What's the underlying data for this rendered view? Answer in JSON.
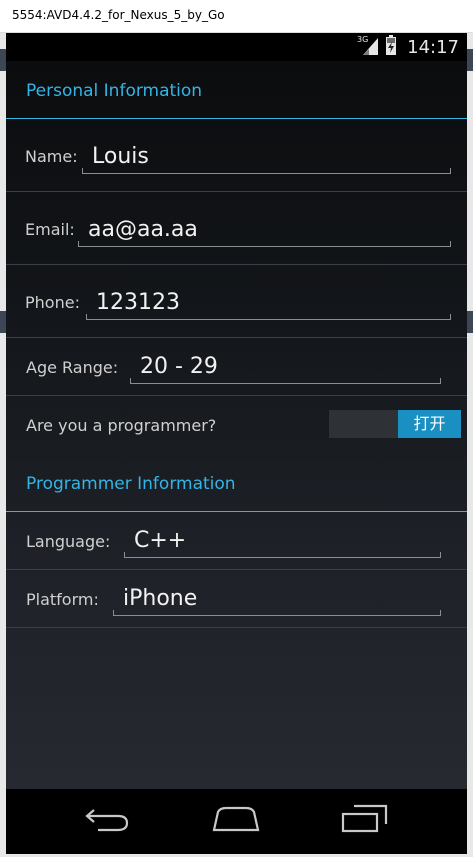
{
  "window": {
    "title": "5554:AVD4.4.2_for_Nexus_5_by_Go"
  },
  "status_bar": {
    "network": "3G",
    "time": "14:17"
  },
  "sections": {
    "personal": {
      "title": "Personal Information",
      "name": {
        "label": "Name:",
        "value": "Louis"
      },
      "email": {
        "label": "Email:",
        "value": "aa@aa.aa"
      },
      "phone": {
        "label": "Phone:",
        "value": "123123"
      },
      "age_range": {
        "label": "Age Range:",
        "value": "20 - 29"
      },
      "programmer": {
        "label": "Are you a programmer?",
        "toggle_on_text": "打开",
        "is_on": true
      }
    },
    "programmer": {
      "title": "Programmer Information",
      "language": {
        "label": "Language:",
        "value": "C++"
      },
      "platform": {
        "label": "Platform:",
        "value": "iPhone"
      }
    }
  },
  "nav_bar": {
    "icons": [
      "back-icon",
      "home-icon",
      "recents-icon"
    ]
  },
  "colors": {
    "accent": "#33b5e5",
    "toggle_on": "#1a8fc1",
    "background": "#1d2026"
  }
}
